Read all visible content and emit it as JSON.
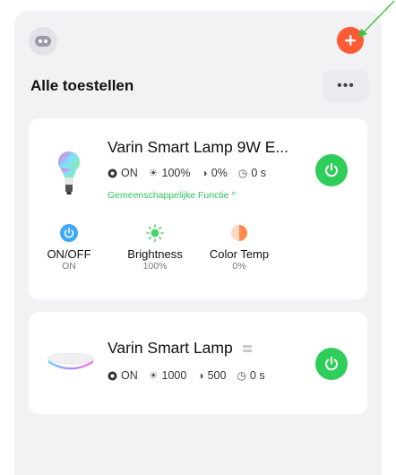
{
  "header": {
    "avatar_icon": "robot-face-icon",
    "add_icon": "plus-icon",
    "accent_color": "#ff5a36"
  },
  "section": {
    "title": "Alle toestellen",
    "more_label": "•••"
  },
  "devices": [
    {
      "name": "Varin Smart Lamp 9W E...",
      "icon": "rgb-bulb-icon",
      "status": {
        "power": "ON",
        "brightness": "100%",
        "temp": "0%",
        "timer": "0 s"
      },
      "function_link": "Gemeenschappelijke Functie ^",
      "power_color": "#2fcd5a",
      "quick_actions": [
        {
          "label": "ON/OFF",
          "value": "ON",
          "icon": "power-icon",
          "color": "#3ea9f5"
        },
        {
          "label": "Brightness",
          "value": "100%",
          "icon": "sun-icon",
          "color": "#4bd469"
        },
        {
          "label": "Color Temp",
          "value": "0%",
          "icon": "color-temp-icon",
          "color": "#ff8a4c"
        }
      ]
    },
    {
      "name": "Varin Smart Lamp",
      "icon": "ceiling-lamp-icon",
      "status": {
        "power": "ON",
        "brightness": "1000",
        "temp": "500",
        "timer": "0 s"
      },
      "power_color": "#2fcd5a"
    }
  ]
}
